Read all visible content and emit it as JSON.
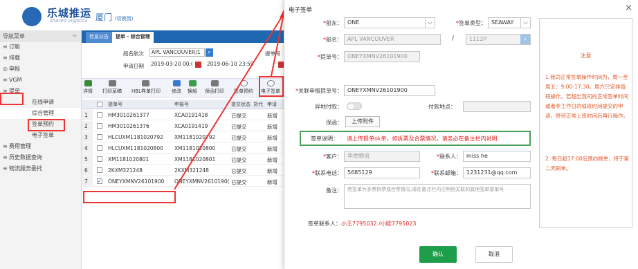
{
  "header": {
    "logo_text": "乐城推运",
    "logo_sub": "shared logistics",
    "city": "厦门",
    "switch": "(切换到)"
  },
  "sidebar": {
    "title": "导航菜单",
    "items": [
      {
        "icon": "≡",
        "label": "订舱"
      },
      {
        "icon": "≡",
        "label": "排载"
      },
      {
        "icon": "◎",
        "label": "申报"
      },
      {
        "icon": "≡",
        "label": "VGM"
      },
      {
        "icon": "≡",
        "label": "提单"
      }
    ],
    "subitems": [
      "在线申请",
      "综合管理",
      "签单预约",
      "电子签单"
    ],
    "more": [
      {
        "icon": "≡",
        "label": "费用管理"
      },
      {
        "icon": "≡",
        "label": "历史数据查询"
      },
      {
        "icon": "≡",
        "label": "物流服务委托"
      }
    ]
  },
  "tabs": {
    "tab1": "信息公告",
    "tab2": "提单 - 综合管理"
  },
  "filter": {
    "ship_label": "船名航次",
    "ship_value": "APL VANCOUVER/1",
    "bl_label": "提单号",
    "date_label": "申请日期",
    "date_from": "2019-03-20 00:00",
    "date_to": "2019-06-10 23:59"
  },
  "toolbar": [
    "详情",
    "打印草稿",
    "HBL样单打印",
    "修改",
    "换船",
    "保函打印",
    "签单预约",
    "电子签单"
  ],
  "table": {
    "headers": [
      "提单号",
      "申报号",
      "提交状态",
      "货代",
      "申请"
    ],
    "rows": [
      {
        "n": "1",
        "bl": "HM3010261377",
        "decl": "XCA0191418",
        "status": "已提交",
        "extra": "新增"
      },
      {
        "n": "2",
        "bl": "HM3010261376",
        "decl": "XCA0191419",
        "status": "已提交",
        "extra": "新增"
      },
      {
        "n": "3",
        "bl": "HLCUXM1181020792",
        "decl": "XM1181020792",
        "status": "已提交",
        "extra": "新增"
      },
      {
        "n": "4",
        "bl": "HLCUXM1181020800",
        "decl": "XM1181020800",
        "status": "已提交",
        "extra": "新增"
      },
      {
        "n": "5",
        "bl": "XM1181020801",
        "decl": "XM1181020801",
        "status": "已提交",
        "extra": "新增"
      },
      {
        "n": "6",
        "bl": "2KXM321248",
        "decl": "2KXM321248",
        "status": "已提交",
        "extra": "新增"
      },
      {
        "n": "7",
        "bl": "ONEYXMNV26101900",
        "decl": "ONEYXMNV2610190(",
        "status": "已提交",
        "extra": "新增"
      }
    ]
  },
  "modal": {
    "title": "电子签单",
    "close": "×",
    "carrier_label": "船东：",
    "carrier_value": "ONE",
    "sign_type_label": "签单类型：",
    "sign_type_value": "SEAWAY",
    "ship_label": "船名：",
    "ship_value": "APL VANCOUVER",
    "voyage_sep": "/",
    "voyage_value": "1112P",
    "bl_label": "提单号：",
    "bl_value": "ONEYXMNV26101900",
    "rel_bl_label": "关联申报提单号：",
    "rel_bl_value": "ONEYXMNV26101900",
    "remote_pay_label": "异地付款：",
    "pay_place_label": "付款地点：",
    "guarantee_label": "保函：",
    "upload_label": "上传附件",
    "note_label": "签单说明：",
    "note_text": "请上传提单ok单，如拆票及合票情况，请务必在备注栏内说明",
    "customer_label": "客户：",
    "customer_value": "华龙物流",
    "contact_label": "联系人：",
    "contact_value": "miss he",
    "phone_label": "联系电话：",
    "phone_value": "5685129",
    "email_label": "联系邮箱：",
    "email_value": "1231231@qq.com",
    "remark_label": "备注：",
    "remark_placeholder": "若签单为多票拆票或合票情况,请在备注栏内注明相关联的其他签单提单号",
    "signer_label": "签单联系人：",
    "signer_value": "小王7795032 /小欧7795023",
    "ok": "确认",
    "cancel": "取消"
  },
  "notice": {
    "title": "注意",
    "p1": "1.我司正常签单操作时间为，周一至周五：9:00-17:30。周六只安排值班操作。若超出我司的正常签单时间或者非工作日的值班时间提交的申请，将待正常上班时间后再行操作。",
    "p2": "2. 每日超17:00后预约刷单，将于第二天刷单。"
  },
  "colors": {
    "header_blue": "#1f67b0",
    "ok_green": "#1e9e4a",
    "notice_orange": "#e15a2a",
    "highlight_red": "#e33"
  }
}
